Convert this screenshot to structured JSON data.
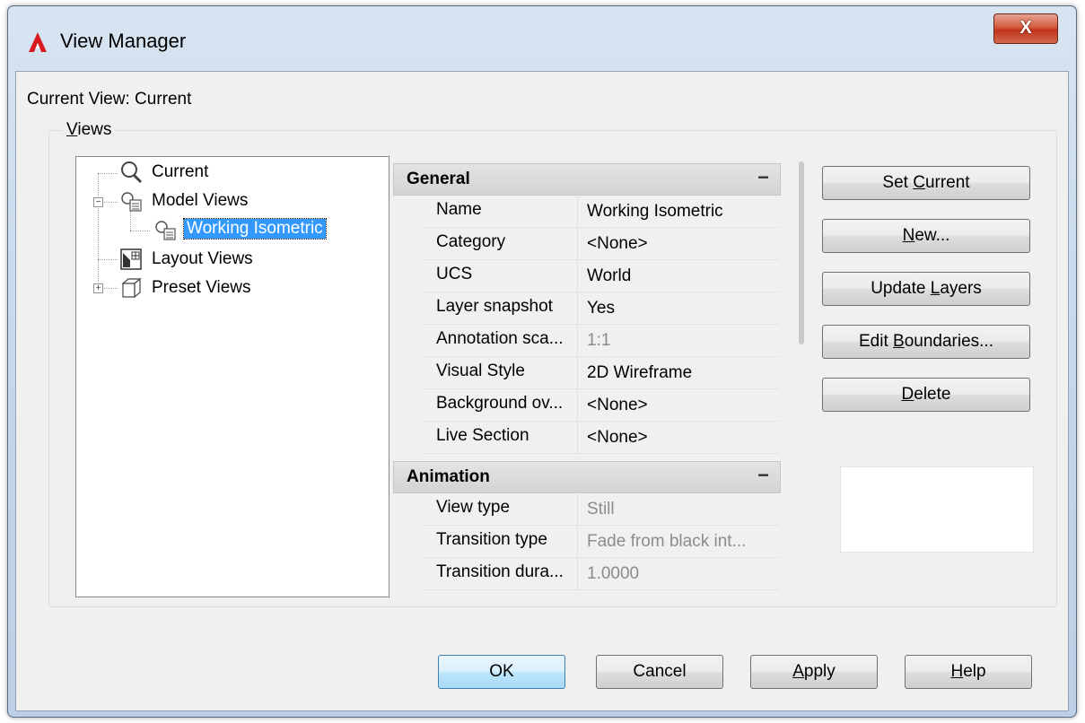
{
  "window": {
    "title": "View Manager",
    "close_glyph": "X",
    "logo_icon": "autocad-logo-icon"
  },
  "current_view": {
    "label": "Current View: Current"
  },
  "views_group": {
    "legend_accel": "V",
    "legend_rest": "iews"
  },
  "tree": {
    "items": [
      {
        "label": "Current",
        "icon": "magnifier-icon"
      },
      {
        "label": "Model Views",
        "icon": "model-views-icon",
        "expander": "−"
      },
      {
        "label": "Working Isometric",
        "icon": "named-view-icon",
        "selected": true
      },
      {
        "label": "Layout Views",
        "icon": "layout-views-icon"
      },
      {
        "label": "Preset Views",
        "icon": "preset-views-icon",
        "expander": "+"
      }
    ]
  },
  "properties": {
    "general": {
      "title": "General",
      "collapse": "−",
      "rows": [
        {
          "name": "Name",
          "value": "Working Isometric",
          "disabled": false
        },
        {
          "name": "Category",
          "value": "<None>",
          "disabled": false
        },
        {
          "name": "UCS",
          "value": "World",
          "disabled": false
        },
        {
          "name": "Layer snapshot",
          "value": "Yes",
          "disabled": false
        },
        {
          "name": "Annotation sca...",
          "value": "1:1",
          "disabled": true
        },
        {
          "name": "Visual Style",
          "value": "2D Wireframe",
          "disabled": false
        },
        {
          "name": "Background ov...",
          "value": "<None>",
          "disabled": false
        },
        {
          "name": "Live Section",
          "value": "<None>",
          "disabled": false
        }
      ]
    },
    "animation": {
      "title": "Animation",
      "collapse": "−",
      "rows": [
        {
          "name": "View type",
          "value": "Still",
          "disabled": true
        },
        {
          "name": "Transition type",
          "value": "Fade from black int...",
          "disabled": true
        },
        {
          "name": "Transition dura...",
          "value": "1.0000",
          "disabled": true
        }
      ]
    }
  },
  "side_buttons": {
    "set_current": {
      "pre": "Set ",
      "accel": "C",
      "post": "urrent"
    },
    "new": {
      "pre": "",
      "accel": "N",
      "post": "ew..."
    },
    "update_layers": {
      "pre": "Update ",
      "accel": "L",
      "post": "ayers"
    },
    "edit_boundaries": {
      "pre": "Edit ",
      "accel": "B",
      "post": "oundaries..."
    },
    "delete": {
      "pre": "",
      "accel": "D",
      "post": "elete"
    }
  },
  "bottom_buttons": {
    "ok": "OK",
    "cancel": "Cancel",
    "apply": {
      "pre": "",
      "accel": "A",
      "post": "pply"
    },
    "help": {
      "pre": "",
      "accel": "H",
      "post": "elp"
    }
  },
  "colors": {
    "selection": "#3399ff",
    "title_gradient_top": "#d7e4f1",
    "close_red": "#c0341b"
  }
}
